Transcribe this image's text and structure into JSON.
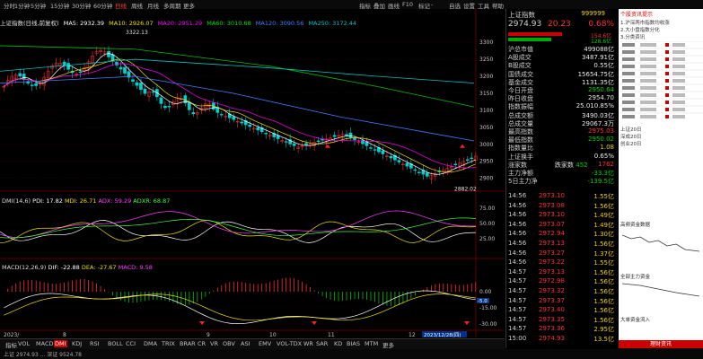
{
  "top_menu": [
    "分时",
    "1分钟",
    "5分钟",
    "15分钟",
    "30分钟",
    "60分钟",
    "日线",
    "周线",
    "月线",
    "多周期",
    "更多",
    "指标",
    "叠加",
    "画线",
    "F10",
    "标记",
    "-",
    "自选",
    "设置",
    "工具",
    "帮助"
  ],
  "top_menu_active": "日线",
  "chart_header": {
    "title": "上证指数(日线,前复权)",
    "ma5": "MA5: 2932.39",
    "ma10": "MA10: 2926.07",
    "ma20": "MA20: 2951.29",
    "ma60": "MA60: 3010.68",
    "ma120": "MA120: 3090.56",
    "ma250": "MA250: 3172.44"
  },
  "price_axis": [
    "3300",
    "3250",
    "3200",
    "3150",
    "3100",
    "3050",
    "3000",
    "2950",
    "2900"
  ],
  "annotations": {
    "high": "3322.13",
    "low": "2882.02"
  },
  "dmi": {
    "label": "DMI(14,6)",
    "pdi": "PDI: 17.82",
    "mdi": "MDI: 26.71",
    "adx": "ADX: 59.29",
    "adxr": "ADXR: 68.87",
    "axis": [
      "75.00",
      "50.00",
      "25.00"
    ]
  },
  "macd": {
    "label": "MACD(12,26,9)",
    "dif": "DIF: -22.88",
    "dea": "DEA: -27.67",
    "macd": "MACD: 9.58",
    "axis": [
      "0.00",
      "-15.00",
      "-30.00"
    ],
    "marker": "-5.0"
  },
  "x_labels": [
    "2023/",
    "8",
    "9",
    "10",
    "11",
    "12",
    "2023/12/28(四)"
  ],
  "bottom_tabs": [
    "指标",
    "VOL",
    "MACD",
    "DMI",
    "KDJ",
    "RSI",
    "BOLL",
    "CCI",
    "DMA",
    "TRIX",
    "BRAR",
    "CR",
    "VR",
    "OBV",
    "ASI",
    "EMV",
    "VOL-TDX",
    "WR",
    "SAR",
    "KD",
    "BIAS",
    "MTM",
    "更多"
  ],
  "bottom_tabs_active": "DMI",
  "status_left": "上证 2974.93 ... 深证 9524.78",
  "quote": {
    "name": "上证指数",
    "code": "999999",
    "price": "2974.93",
    "change": "20.23",
    "pct": "0.68%",
    "bar_a": "154.6亿",
    "bar_b": "128.6亿",
    "rows": [
      {
        "k": "沪总市值",
        "v": "499088亿",
        "c": "white"
      },
      {
        "k": "A股成交",
        "v": "3487.91亿",
        "c": "white"
      },
      {
        "k": "B股成交",
        "v": "0.55亿",
        "c": "white"
      },
      {
        "k": "国债成交",
        "v": "15654.75亿",
        "c": "white"
      },
      {
        "k": "基金成交",
        "v": "1131.35亿",
        "c": "white"
      },
      {
        "k": "今日开盘",
        "v": "2950.64",
        "c": "green"
      },
      {
        "k": "昨日收盘",
        "v": "2954.70",
        "c": "white"
      },
      {
        "k": "指数振幅",
        "v": "25.010.85%",
        "c": "white"
      },
      {
        "k": "总成交额",
        "v": "3490.03亿",
        "c": "white"
      },
      {
        "k": "总成交量",
        "v": "29067.3万",
        "c": "white"
      },
      {
        "k": "最高指数",
        "v": "2975.03",
        "c": "red"
      },
      {
        "k": "最低指数",
        "v": "2950.02",
        "c": "green"
      },
      {
        "k": "指数量比",
        "v": "1.08",
        "c": "yellow"
      },
      {
        "k": "上证换手",
        "v": "0.65%",
        "c": "white"
      },
      {
        "k": "涨家数",
        "v": "1762",
        "c": "red"
      },
      {
        "k": "主力净额",
        "v": "-33.3亿",
        "c": "green"
      },
      {
        "k": "5日主力净",
        "v": "-139.5亿",
        "c": "green"
      }
    ],
    "up_down": {
      "up": "1762",
      "down_label": "跌家数",
      "down": "452"
    },
    "ticks": [
      {
        "t": "14:56",
        "p": "2973.10",
        "v": "1.55亿"
      },
      {
        "t": "14:56",
        "p": "2973.08",
        "v": "1.56亿"
      },
      {
        "t": "14:56",
        "p": "2973.10",
        "v": "1.49亿"
      },
      {
        "t": "14:56",
        "p": "2973.07",
        "v": "1.49亿"
      },
      {
        "t": "14:56",
        "p": "2972.94",
        "v": "1.30亿"
      },
      {
        "t": "14:56",
        "p": "2973.13",
        "v": "1.56亿"
      },
      {
        "t": "14:56",
        "p": "2973.27",
        "v": "1.37亿"
      },
      {
        "t": "14:56",
        "p": "2973.22",
        "v": "1.55亿"
      },
      {
        "t": "14:57",
        "p": "2973.13",
        "v": "1.56亿"
      },
      {
        "t": "14:57",
        "p": "2972.98",
        "v": "1.56亿"
      },
      {
        "t": "14:57",
        "p": "2973.32",
        "v": "1.56亿"
      },
      {
        "t": "14:57",
        "p": "2973.37",
        "v": "1.56亿"
      },
      {
        "t": "14:57",
        "p": "2973.40",
        "v": "1.56亿"
      },
      {
        "t": "14:57",
        "p": "2973.35",
        "v": "1.56亿"
      },
      {
        "t": "14:57",
        "p": "2973.36",
        "v": "2.95亿"
      },
      {
        "t": "15:00",
        "p": "2974.93",
        "v": "13.5亿"
      }
    ]
  },
  "right_panel": {
    "header": "个股资讯提示",
    "items": [
      "1.沪深两市指数均收涨",
      "2.大小盘指数分化",
      "3.分类资讯"
    ],
    "market_rows": [
      "上证20日",
      "深成20日",
      "创业20日"
    ],
    "section1": "高频资金数据",
    "section2": "全部主力资金",
    "section3": "大单资金流入",
    "brand": "理财资讯"
  }
}
